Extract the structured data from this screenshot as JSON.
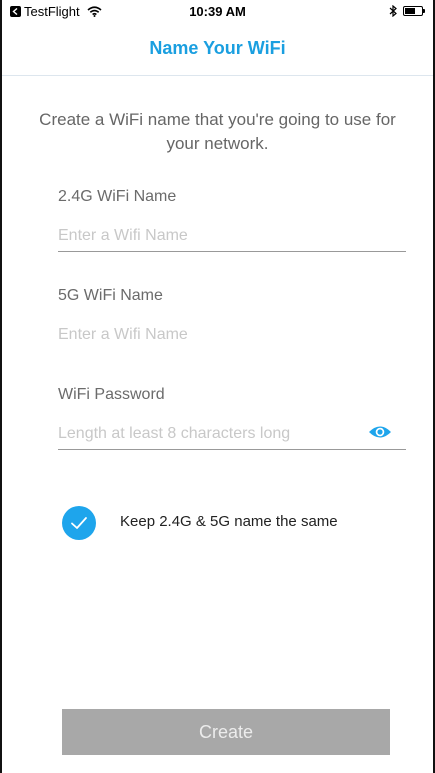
{
  "status_bar": {
    "app_back_label": "TestFlight",
    "time": "10:39 AM",
    "battery_level": 0.65
  },
  "nav": {
    "title": "Name Your WiFi"
  },
  "intro": {
    "text": "Create a WiFi name that you're going to use for your network."
  },
  "fields": {
    "wifi_24": {
      "label": "2.4G WiFi Name",
      "placeholder": "Enter a Wifi Name",
      "value": ""
    },
    "wifi_5": {
      "label": "5G WiFi Name",
      "placeholder": "Enter a Wifi Name",
      "value": ""
    },
    "password": {
      "label": "WiFi Password",
      "placeholder": "Length at least 8 characters long",
      "value": ""
    }
  },
  "same_name": {
    "label": "Keep 2.4G & 5G name the same",
    "checked": true
  },
  "create_button": {
    "label": "Create",
    "enabled": false
  },
  "colors": {
    "accent": "#1ea5ec",
    "title": "#1a9fe0",
    "button_disabled": "#a8a8a8"
  }
}
